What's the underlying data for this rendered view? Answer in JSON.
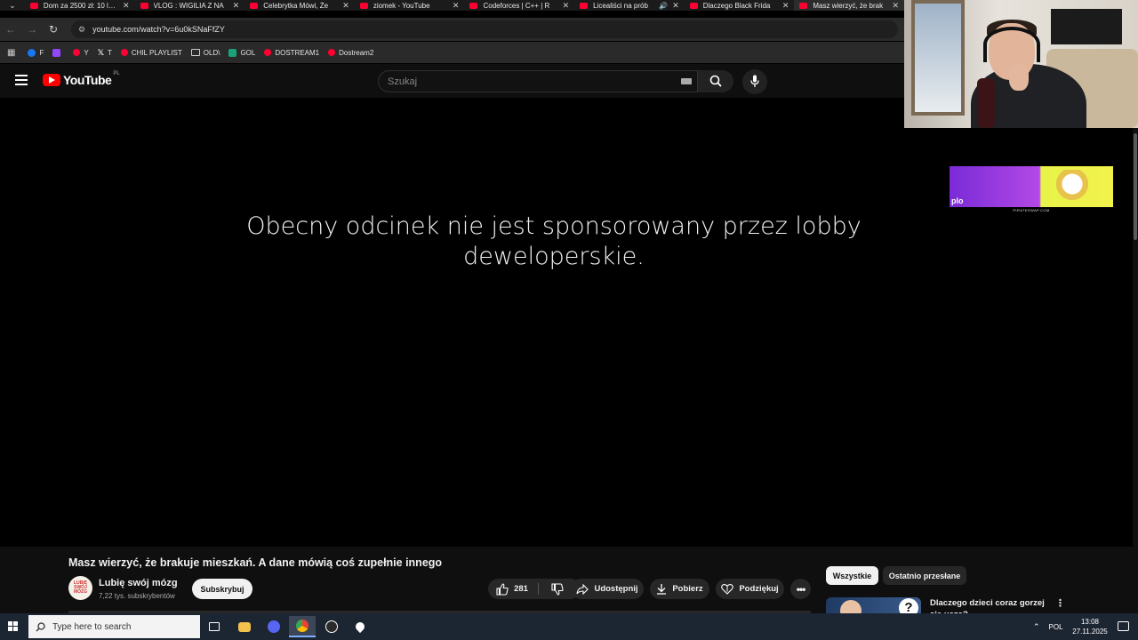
{
  "browser": {
    "tabs": [
      {
        "title": "Dom za 2500 zł: 10 l…",
        "active": false
      },
      {
        "title": "VLOG : WIGILIA Z NA",
        "active": false
      },
      {
        "title": "Celebrytka Mówi, Że",
        "active": false
      },
      {
        "title": "ziomek - YouTube",
        "active": false
      },
      {
        "title": "Codeforces | C++ | R",
        "active": false
      },
      {
        "title": "Licealiści na prób",
        "active": false
      },
      {
        "title": "Dlaczego Black Frida",
        "active": false
      },
      {
        "title": "Masz wierzyć, że brak",
        "active": true
      }
    ],
    "url": "youtube.com/watch?v=6u0kSNaFfZY",
    "bookmarks": [
      {
        "label": "F",
        "icon": "facebook-icon"
      },
      {
        "label": "",
        "icon": "twitch-icon"
      },
      {
        "label": "Y",
        "icon": "youtube-icon"
      },
      {
        "label": "T",
        "icon": "x-icon"
      },
      {
        "label": "CHIL PLAYLIST",
        "icon": "youtube-icon"
      },
      {
        "label": "OLD\\",
        "icon": "folder-icon"
      },
      {
        "label": "GOL",
        "icon": "grid-icon"
      },
      {
        "label": "DOSTREAM1",
        "icon": "youtube-icon"
      },
      {
        "label": "Dostream2",
        "icon": "youtube-icon"
      }
    ]
  },
  "youtube": {
    "logo_text": "YouTube",
    "country": "PL",
    "search_placeholder": "Szukaj"
  },
  "video": {
    "caption": "Obecny odcinek nie jest sponsorowany przez lobby deweloperskie."
  },
  "ad": {
    "logo_text": "plo",
    "caption": "PIRATESWAP.COM"
  },
  "info": {
    "title": "Masz wierzyć, że brakuje mieszkań. A dane mówią coś zupełnie innego",
    "channel_name": "Lubię swój mózg",
    "channel_avatar_text": "LUBIĘ SWÓJ MÓZG",
    "subscribers": "7,22 tys. subskrybentów",
    "subscribe_label": "Subskrybuj",
    "likes": "281",
    "share_label": "Udostępnij",
    "download_label": "Pobierz",
    "thanks_label": "Podziękuj",
    "more_label": "•••"
  },
  "sidebar": {
    "chips": [
      "Wszystkie",
      "Ostatnio przesłane"
    ],
    "recommendation_title": "Dlaczego dzieci coraz gorzej się ucza?"
  },
  "taskbar": {
    "search_placeholder": "Type here to search",
    "language": "POL",
    "time": "13:08",
    "date": "27.11.2025"
  }
}
